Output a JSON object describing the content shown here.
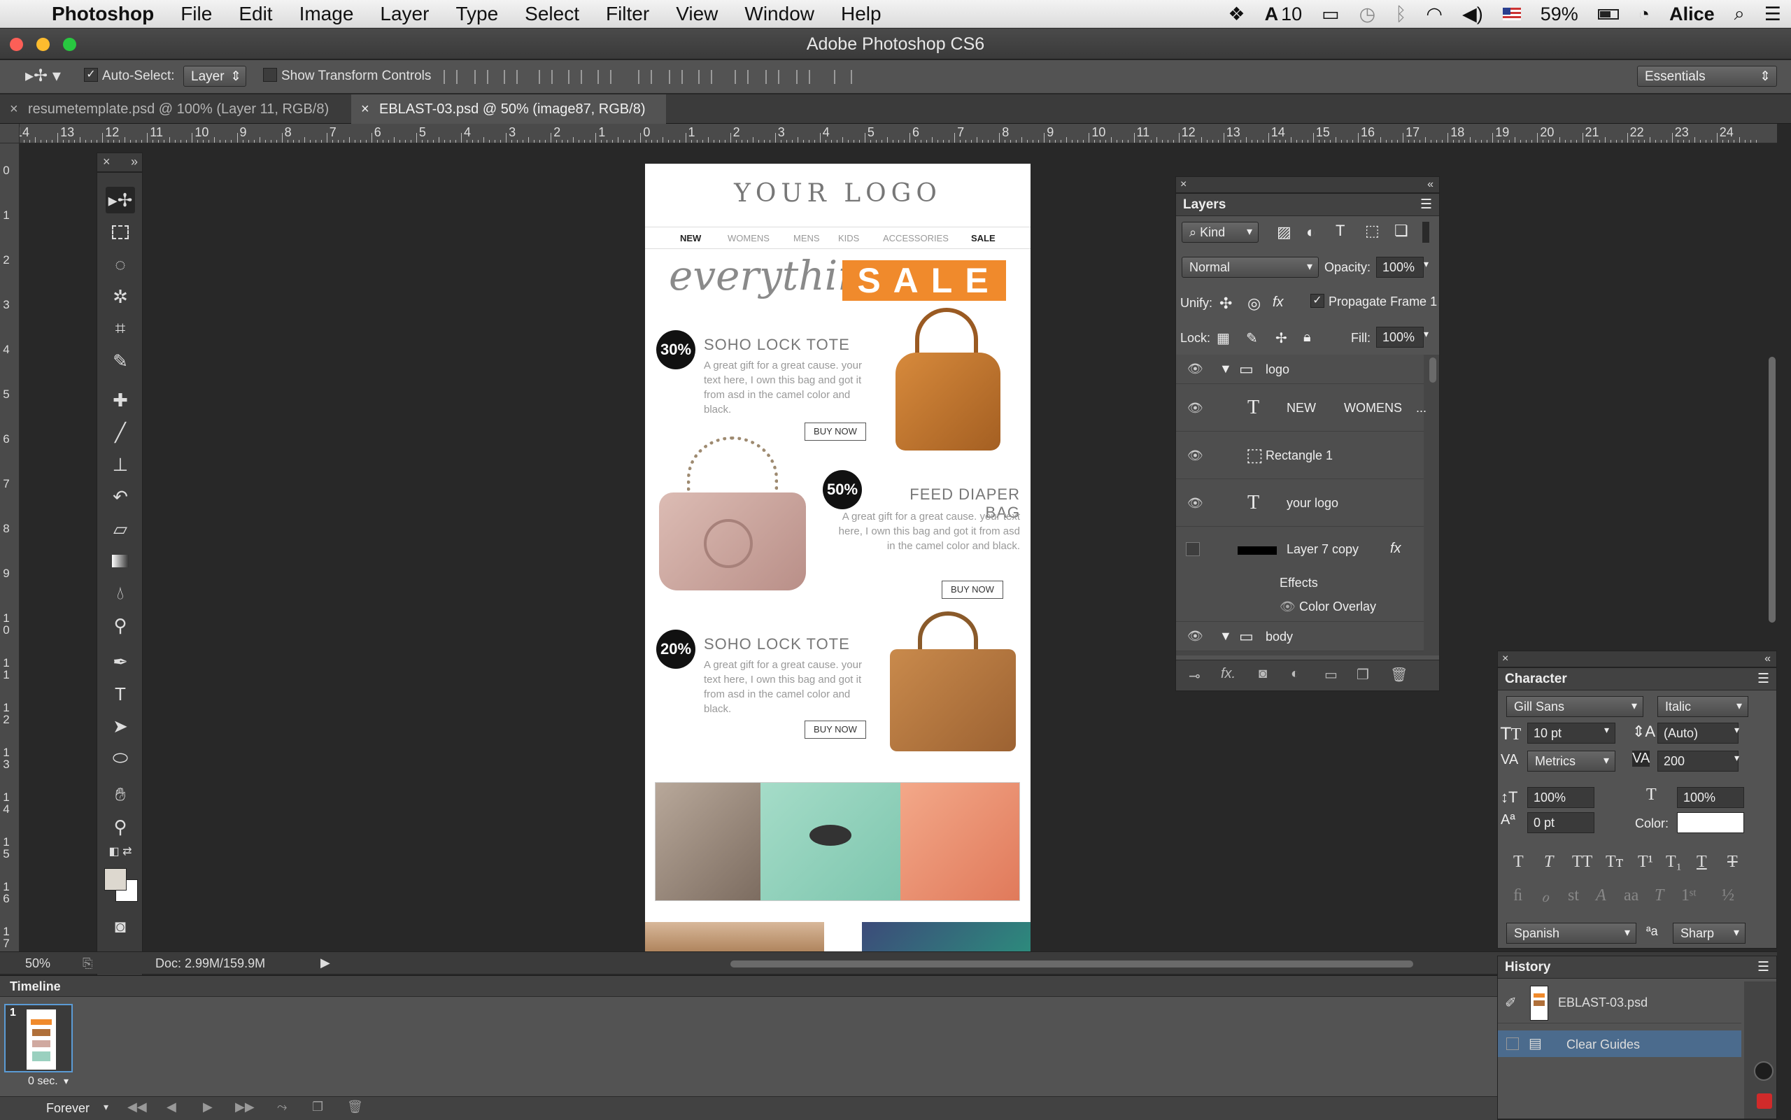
{
  "menubar": {
    "app": "Photoshop",
    "items": [
      "File",
      "Edit",
      "Image",
      "Layer",
      "Type",
      "Select",
      "Filter",
      "View",
      "Window",
      "Help"
    ],
    "adobe_num": "10",
    "battery": "59%",
    "user": "Alice"
  },
  "window": {
    "title": "Adobe Photoshop CS6"
  },
  "options": {
    "auto_select_label": "Auto-Select:",
    "auto_select_value": "Layer",
    "transform_label": "Show Transform Controls",
    "workspace": "Essentials"
  },
  "tabs": [
    {
      "label": "resumetemplate.psd @ 100% (Layer 11, RGB/8) *"
    },
    {
      "label": "EBLAST-03.psd @ 50% (image87, RGB/8) *"
    }
  ],
  "ruler_top": [
    "14",
    "13",
    "12",
    "11",
    "10",
    "9",
    "8",
    "7",
    "6",
    "5",
    "4",
    "3",
    "2",
    "1",
    "0",
    "1",
    "2",
    "3",
    "4",
    "5",
    "6",
    "7",
    "8",
    "9",
    "10",
    "11",
    "12",
    "13",
    "14",
    "15",
    "16",
    "17",
    "18",
    "19",
    "20",
    "21",
    "22",
    "23",
    "24"
  ],
  "ruler_left": [
    "0",
    "1",
    "2",
    "3",
    "4",
    "5",
    "6",
    "7",
    "8",
    "9",
    "10",
    "11",
    "12",
    "13",
    "14",
    "15",
    "16",
    "17"
  ],
  "canvas": {
    "logo": "YOUR LOGO",
    "nav": [
      "NEW",
      "WOMENS",
      "MENS",
      "KIDS",
      "ACCESSORIES",
      "SALE"
    ],
    "script": "everything",
    "sale": "SALE",
    "products": [
      {
        "badge": "30%",
        "title": "SOHO LOCK TOTE",
        "desc": "A great gift for a great cause. your text here, I own this bag and got it from asd in the camel color and black.",
        "cta": "BUY NOW"
      },
      {
        "badge": "50%",
        "title": "FEED DIAPER BAG",
        "desc": "A great gift for a great cause. your text here, I own this bag and got it from asd in the camel color and black.",
        "cta": "BUY NOW"
      },
      {
        "badge": "20%",
        "title": "SOHO LOCK TOTE",
        "desc": "A great gift for a great cause. your text here, I own this bag and got it from asd in the camel color and black.",
        "cta": "BUY NOW"
      }
    ]
  },
  "status": {
    "zoom": "50%",
    "doc": "Doc: 2.99M/159.9M"
  },
  "timeline": {
    "title": "Timeline",
    "frame_num": "1",
    "frame_delay": "0 sec.",
    "loop": "Forever"
  },
  "layers": {
    "title": "Layers",
    "kind": "Kind",
    "blend": "Normal",
    "opacity_label": "Opacity:",
    "opacity": "100%",
    "unify_label": "Unify:",
    "propagate": "Propagate Frame 1",
    "lock_label": "Lock:",
    "fill_label": "Fill:",
    "fill": "100%",
    "rows": [
      {
        "name": "logo",
        "type": "group"
      },
      {
        "name": "NEW        WOMENS    ...",
        "type": "text"
      },
      {
        "name": "Rectangle 1",
        "type": "shape"
      },
      {
        "name": "your logo",
        "type": "text"
      },
      {
        "name": "Layer 7 copy",
        "type": "pixel"
      },
      {
        "name": "Effects",
        "type": "effects"
      },
      {
        "name": "Color Overlay",
        "type": "effect"
      },
      {
        "name": "body",
        "type": "group"
      }
    ]
  },
  "character": {
    "title": "Character",
    "font": "Gill Sans",
    "style": "Italic",
    "size": "10 pt",
    "leading": "(Auto)",
    "kerning": "Metrics",
    "tracking": "200",
    "vscale": "100%",
    "hscale": "100%",
    "baseline": "0 pt",
    "color_label": "Color:",
    "language": "Spanish",
    "antialias": "Sharp"
  },
  "history": {
    "title": "History",
    "items": [
      {
        "label": "EBLAST-03.psd"
      },
      {
        "label": "Clear Guides"
      }
    ]
  },
  "colors": {
    "accent": "#f08a2c",
    "panel": "#535353",
    "dark": "#282828"
  }
}
